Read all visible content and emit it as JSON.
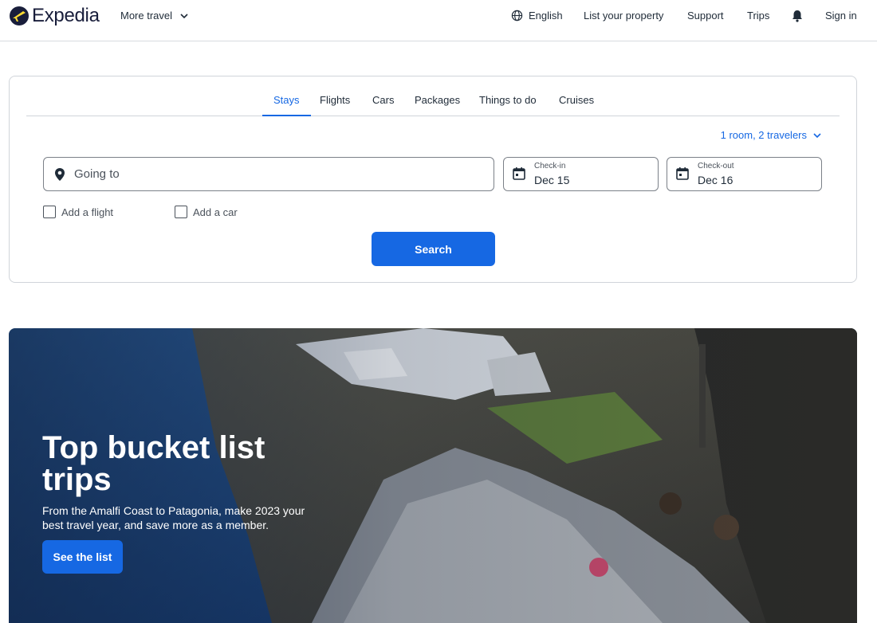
{
  "header": {
    "logo_text": "Expedia",
    "more_travel": "More travel",
    "language": "English",
    "list_property": "List your property",
    "support": "Support",
    "trips": "Trips",
    "sign_in": "Sign in"
  },
  "search": {
    "tabs": [
      {
        "label": "Stays",
        "active": true
      },
      {
        "label": "Flights",
        "active": false
      },
      {
        "label": "Cars",
        "active": false
      },
      {
        "label": "Packages",
        "active": false
      },
      {
        "label": "Things to do",
        "active": false
      },
      {
        "label": "Cruises",
        "active": false
      }
    ],
    "travelers": "1 room, 2 travelers",
    "going_to_placeholder": "Going to",
    "checkin_label": "Check-in",
    "checkin_value": "Dec 15",
    "checkout_label": "Check-out",
    "checkout_value": "Dec 16",
    "add_flight": "Add a flight",
    "add_car": "Add a car",
    "search_button": "Search"
  },
  "hero": {
    "title": "Top bucket list trips",
    "subtitle": "From the Amalfi Coast to Patagonia, make 2023 your best travel year, and save more as a member.",
    "button": "See the list"
  },
  "colors": {
    "brand_blue": "#1668e3",
    "logo_yellow": "#fddb32",
    "logo_navy": "#191e3b",
    "text": "#1f2b38"
  },
  "icons": [
    "expedia-logo-icon",
    "chevron-down-icon",
    "globe-icon",
    "bell-icon",
    "map-pin-icon",
    "calendar-icon",
    "checkbox-icon"
  ]
}
